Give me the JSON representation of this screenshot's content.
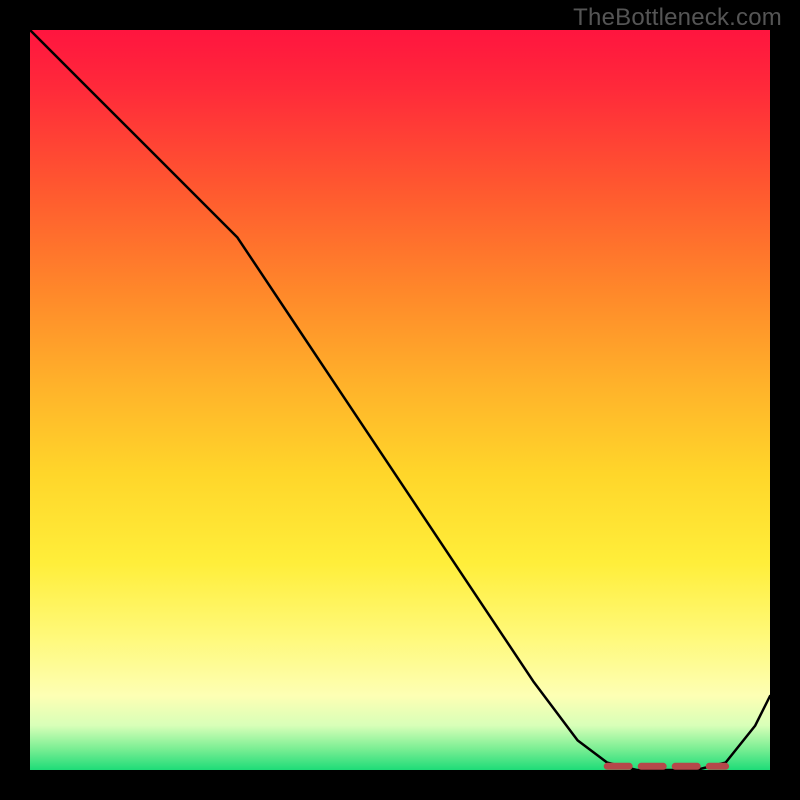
{
  "watermark": "TheBottleneck.com",
  "colors": {
    "frame": "#000000",
    "line": "#000000",
    "dash": "#b5484a",
    "gradient_stops": [
      "#ff153f",
      "#ff2a3a",
      "#ff5a2f",
      "#ff8a2a",
      "#ffb22a",
      "#ffd62a",
      "#ffee3a",
      "#fff97a",
      "#fdffb4",
      "#d8ffb8",
      "#7fef95",
      "#1edc78"
    ]
  },
  "chart_data": {
    "type": "line",
    "title": "",
    "xlabel": "",
    "ylabel": "",
    "xlim": [
      0,
      100
    ],
    "ylim": [
      0,
      100
    ],
    "grid": false,
    "legend": false,
    "note": "No axes or tick labels are rendered; values are read from relative position (0–100 each axis). Line rises toward 100 at top; 0 at bottom. Dashed segment marks near-zero trough.",
    "series": [
      {
        "name": "bottleneck-curve",
        "x": [
          0,
          8,
          16,
          24,
          28,
          36,
          44,
          52,
          60,
          68,
          74,
          78,
          82,
          86,
          90,
          94,
          98,
          100
        ],
        "values": [
          100,
          92,
          84,
          76,
          72,
          60,
          48,
          36,
          24,
          12,
          4,
          1,
          0,
          0,
          0,
          1,
          6,
          10
        ]
      }
    ],
    "annotations": [
      {
        "name": "optimal-zone-dash",
        "x_range": [
          78,
          94
        ],
        "y": 0.5
      }
    ]
  }
}
